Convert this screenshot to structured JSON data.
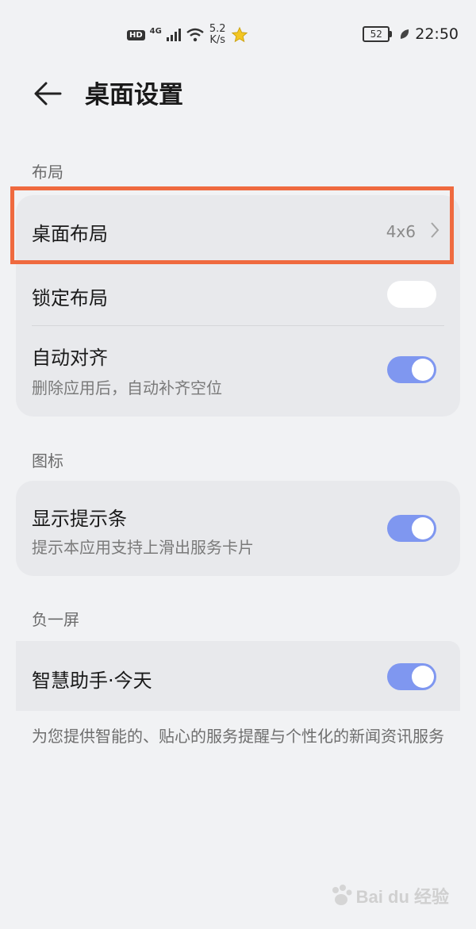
{
  "status_bar": {
    "hd": "HD",
    "network": "4G",
    "speed_value": "5.2",
    "speed_unit": "K/s",
    "battery": "52",
    "time": "22:50"
  },
  "header": {
    "title": "桌面设置"
  },
  "sections": {
    "layout": {
      "label": "布局",
      "desktop_layout": {
        "title": "桌面布局",
        "value": "4x6"
      },
      "lock_layout": {
        "title": "锁定布局",
        "toggle_on": false
      },
      "auto_align": {
        "title": "自动对齐",
        "subtitle": "删除应用后，自动补齐空位",
        "toggle_on": true
      }
    },
    "icons": {
      "label": "图标",
      "show_hint": {
        "title": "显示提示条",
        "subtitle": "提示本应用支持上滑出服务卡片",
        "toggle_on": true
      }
    },
    "minus_one": {
      "label": "负一屏",
      "assistant": {
        "title": "智慧助手·今天",
        "toggle_on": true
      },
      "footnote": "为您提供智能的、贴心的服务提醒与个性化的新闻资讯服务"
    }
  },
  "colors": {
    "accent": "#7f97f0",
    "highlight": "#ef6a3f",
    "background": "#f1f2f4",
    "card": "#e8e9ec"
  },
  "watermark": {
    "text": "Bai du 经验"
  }
}
